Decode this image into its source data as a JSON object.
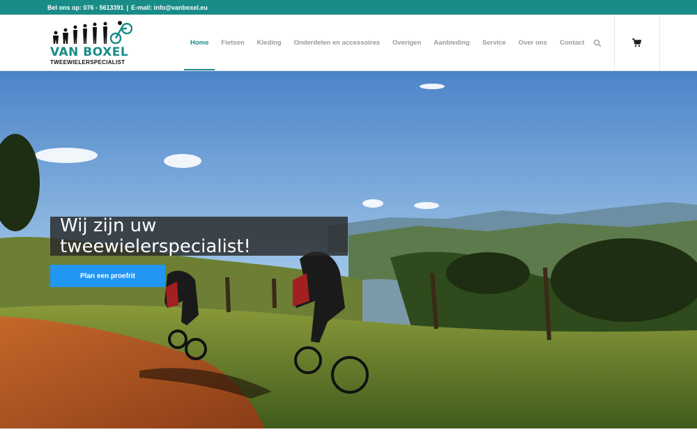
{
  "topbar": {
    "phone_text": "Bel ons op: 076 - 5613391",
    "separator": "|",
    "email_text": "E-mail: info@vanboxel.eu"
  },
  "logo": {
    "brand": "VAN BOXEL",
    "tagline": "TWEEWIELERSPECIALIST"
  },
  "nav": {
    "items": [
      {
        "label": "Home",
        "active": true
      },
      {
        "label": "Fietsen"
      },
      {
        "label": "Kleding"
      },
      {
        "label": "Onderdelen en accessoires"
      },
      {
        "label": "Overigen"
      },
      {
        "label": "Aanbieding"
      },
      {
        "label": "Service"
      },
      {
        "label": "Over ons"
      },
      {
        "label": "Contact"
      }
    ],
    "search_icon": "search-icon",
    "cart_icon": "cart-icon"
  },
  "hero": {
    "heading": "Wij zijn uw tweewielerspecialist!",
    "cta_label": "Plan een proefrit"
  },
  "colors": {
    "brand": "#1a8c88",
    "cta": "#2196f3",
    "nav_text": "#9a9a9a"
  }
}
